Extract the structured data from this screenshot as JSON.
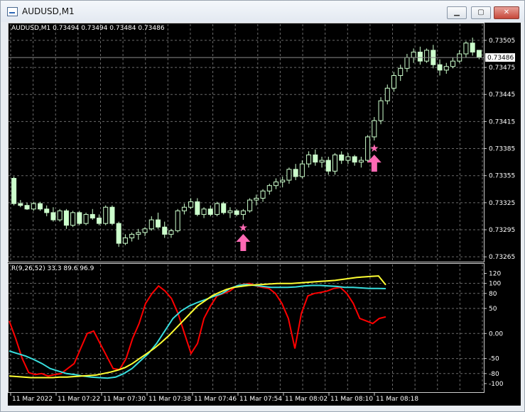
{
  "window": {
    "title": "AUDUSD,M1",
    "buttons": {
      "minimize": "▁",
      "maximize": "▢",
      "close": "✕"
    }
  },
  "price_panel": {
    "info_label": "AUDUSD,M1  0.73494 0.73494 0.73484 0.73486",
    "current_price": "0.73486"
  },
  "indicator_panel": {
    "info_label": "R(9,26,52) 33.3 89.6 96.9"
  },
  "colors": {
    "background": "#000000",
    "grid": "#6b6b6b",
    "candle_bull": "#ccffcc",
    "candle_bear": "#ccffcc",
    "signal_star": "#ff69b4",
    "signal_arrow": "#ff69b4",
    "r_fast": "#ff0000",
    "r_mid": "#38dede",
    "r_slow": "#ffff33",
    "text": "#ffffff"
  },
  "chart_data": [
    {
      "type": "candlestick",
      "title": "AUDUSD,M1",
      "y_ticks": [
        "0.73505",
        "0.73475",
        "0.73445",
        "0.73415",
        "0.73385",
        "0.73355",
        "0.73325",
        "0.73295",
        "0.73265"
      ],
      "ylim": [
        0.73262,
        0.73512
      ],
      "x_ticks": [
        "11 Mar 2022",
        "11 Mar 07:22",
        "11 Mar 07:30",
        "11 Mar 07:38",
        "11 Mar 07:46",
        "11 Mar 07:54",
        "11 Mar 08:02",
        "11 Mar 08:10",
        "11 Mar 08:18"
      ],
      "current_price": 0.73486,
      "candles": [
        [
          0.73352,
          0.73354,
          0.73322,
          0.73324
        ],
        [
          0.73324,
          0.73328,
          0.7332,
          0.73322
        ],
        [
          0.73322,
          0.73325,
          0.73317,
          0.73318
        ],
        [
          0.73318,
          0.73326,
          0.73316,
          0.73324
        ],
        [
          0.73324,
          0.73326,
          0.73316,
          0.73318
        ],
        [
          0.73318,
          0.73322,
          0.7331,
          0.73314
        ],
        [
          0.73314,
          0.7332,
          0.73304,
          0.73306
        ],
        [
          0.73306,
          0.73318,
          0.73304,
          0.73316
        ],
        [
          0.73316,
          0.73318,
          0.73296,
          0.733
        ],
        [
          0.733,
          0.73316,
          0.73298,
          0.73314
        ],
        [
          0.73314,
          0.73316,
          0.733,
          0.73302
        ],
        [
          0.73302,
          0.73314,
          0.733,
          0.73312
        ],
        [
          0.73312,
          0.73318,
          0.73306,
          0.73308
        ],
        [
          0.73308,
          0.73312,
          0.733,
          0.73302
        ],
        [
          0.73302,
          0.73322,
          0.733,
          0.7332
        ],
        [
          0.7332,
          0.73322,
          0.733,
          0.73302
        ],
        [
          0.73302,
          0.73304,
          0.73276,
          0.7328
        ],
        [
          0.7328,
          0.7329,
          0.73278,
          0.73286
        ],
        [
          0.73286,
          0.73292,
          0.73282,
          0.7329
        ],
        [
          0.7329,
          0.73296,
          0.73284,
          0.73292
        ],
        [
          0.73292,
          0.73298,
          0.73288,
          0.73296
        ],
        [
          0.73296,
          0.7331,
          0.73294,
          0.73306
        ],
        [
          0.73306,
          0.73314,
          0.73296,
          0.73298
        ],
        [
          0.73298,
          0.73304,
          0.73286,
          0.7329
        ],
        [
          0.7329,
          0.73296,
          0.73286,
          0.73294
        ],
        [
          0.73294,
          0.73318,
          0.73292,
          0.73316
        ],
        [
          0.73316,
          0.73324,
          0.73312,
          0.7332
        ],
        [
          0.7332,
          0.7333,
          0.73318,
          0.73326
        ],
        [
          0.73326,
          0.7333,
          0.7331,
          0.73312
        ],
        [
          0.73312,
          0.7332,
          0.73308,
          0.73318
        ],
        [
          0.73318,
          0.73322,
          0.7331,
          0.73312
        ],
        [
          0.73312,
          0.73326,
          0.7331,
          0.73324
        ],
        [
          0.73324,
          0.73326,
          0.73312,
          0.73314
        ],
        [
          0.73314,
          0.7332,
          0.73308,
          0.73316
        ],
        [
          0.73316,
          0.73318,
          0.7331,
          0.73312
        ],
        [
          0.73312,
          0.73318,
          0.73306,
          0.73316
        ],
        [
          0.73316,
          0.7333,
          0.73314,
          0.73328
        ],
        [
          0.73328,
          0.73334,
          0.73322,
          0.7333
        ],
        [
          0.7333,
          0.7334,
          0.73326,
          0.73338
        ],
        [
          0.73338,
          0.73346,
          0.73334,
          0.73344
        ],
        [
          0.73344,
          0.73352,
          0.7334,
          0.73348
        ],
        [
          0.73348,
          0.73354,
          0.73342,
          0.7335
        ],
        [
          0.7335,
          0.73364,
          0.73346,
          0.73362
        ],
        [
          0.73362,
          0.73368,
          0.7335,
          0.73354
        ],
        [
          0.73354,
          0.73372,
          0.73352,
          0.73368
        ],
        [
          0.73368,
          0.73382,
          0.73364,
          0.73378
        ],
        [
          0.73378,
          0.73384,
          0.73366,
          0.7337
        ],
        [
          0.7337,
          0.73376,
          0.73364,
          0.73372
        ],
        [
          0.73372,
          0.73376,
          0.73356,
          0.7336
        ],
        [
          0.7336,
          0.7338,
          0.73356,
          0.73378
        ],
        [
          0.73378,
          0.73382,
          0.73368,
          0.73372
        ],
        [
          0.73372,
          0.7338,
          0.73368,
          0.73376
        ],
        [
          0.73376,
          0.73378,
          0.73366,
          0.7337
        ],
        [
          0.7337,
          0.73376,
          0.73364,
          0.73372
        ],
        [
          0.73372,
          0.734,
          0.7337,
          0.73398
        ],
        [
          0.73398,
          0.7342,
          0.73394,
          0.73416
        ],
        [
          0.73416,
          0.73442,
          0.73412,
          0.73438
        ],
        [
          0.73438,
          0.73456,
          0.73434,
          0.73452
        ],
        [
          0.73452,
          0.7347,
          0.73448,
          0.73466
        ],
        [
          0.73466,
          0.73478,
          0.7346,
          0.73474
        ],
        [
          0.73474,
          0.7349,
          0.7347,
          0.73486
        ],
        [
          0.73486,
          0.73496,
          0.7348,
          0.73492
        ],
        [
          0.73492,
          0.73498,
          0.73478,
          0.73482
        ],
        [
          0.73482,
          0.73496,
          0.7348,
          0.73494
        ],
        [
          0.73494,
          0.735,
          0.73474,
          0.73478
        ],
        [
          0.73478,
          0.73484,
          0.73466,
          0.73472
        ],
        [
          0.73472,
          0.7348,
          0.73468,
          0.73476
        ],
        [
          0.73476,
          0.73486,
          0.73474,
          0.73482
        ],
        [
          0.73482,
          0.73494,
          0.7348,
          0.7349
        ],
        [
          0.7349,
          0.73504,
          0.73486,
          0.73502
        ],
        [
          0.73502,
          0.73508,
          0.73488,
          0.73492
        ],
        [
          0.73494,
          0.73494,
          0.73484,
          0.73486
        ]
      ],
      "signals": [
        {
          "index": 35,
          "type": "star"
        },
        {
          "index": 35,
          "type": "up-arrow"
        },
        {
          "index": 55,
          "type": "star"
        },
        {
          "index": 55,
          "type": "up-arrow"
        }
      ]
    },
    {
      "type": "line",
      "title": "R(9,26,52) 33.3 89.6 96.9",
      "y_ticks": [
        "120",
        "100",
        "80",
        "50",
        "0.00",
        "-50",
        "-80",
        "-100"
      ],
      "ylim": [
        -110,
        125
      ],
      "series": [
        {
          "values": [
            25,
            -10,
            -50,
            -78,
            -82,
            -80,
            -85,
            -82,
            -80,
            -70,
            -60,
            -30,
            0,
            5,
            -20,
            -45,
            -70,
            -72,
            -50,
            -10,
            20,
            60,
            80,
            95,
            85,
            70,
            40,
            0,
            -40,
            -20,
            30,
            55,
            75,
            80,
            85,
            95,
            98,
            100,
            95,
            92,
            90,
            80,
            60,
            30,
            -30,
            40,
            75,
            80,
            82,
            85,
            90,
            92,
            80,
            60,
            30,
            25,
            20,
            30,
            33.3
          ]
        },
        {
          "values": [
            -35,
            -40,
            -45,
            -52,
            -60,
            -70,
            -75,
            -80,
            -82,
            -85,
            -87,
            -88,
            -89,
            -87,
            -80,
            -70,
            -55,
            -40,
            -20,
            5,
            30,
            45,
            55,
            62,
            68,
            74,
            80,
            90,
            96,
            98,
            96,
            94,
            92,
            92,
            92,
            93,
            95,
            96,
            96,
            95,
            94,
            92,
            92,
            91,
            90,
            90,
            89.6
          ]
        },
        {
          "values": [
            -85,
            -86,
            -87,
            -88,
            -88,
            -88,
            -88,
            -87,
            -87,
            -86,
            -85,
            -84,
            -83,
            -80,
            -77,
            -73,
            -68,
            -60,
            -50,
            -40,
            -30,
            -18,
            -5,
            10,
            25,
            40,
            55,
            65,
            75,
            82,
            88,
            92,
            94,
            96,
            97,
            98,
            99,
            100,
            100,
            100,
            101,
            102,
            103,
            104,
            105,
            106,
            108,
            110,
            112,
            113,
            114,
            115,
            96.9
          ]
        }
      ]
    }
  ]
}
